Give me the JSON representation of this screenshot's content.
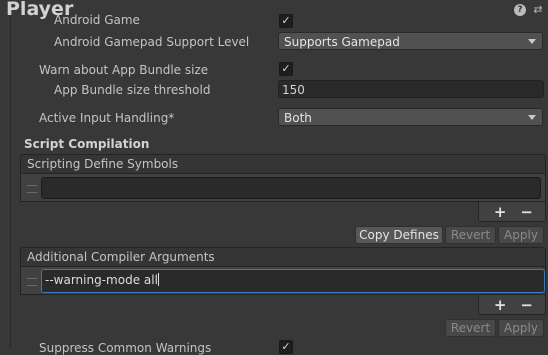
{
  "header": {
    "title": "Player"
  },
  "settings": {
    "android_game_label": "Android Game",
    "android_game_checked": true,
    "gamepad_label": "Android Gamepad Support Level",
    "gamepad_value": "Supports Gamepad",
    "warn_bundle_label": "Warn about App Bundle size",
    "warn_bundle_checked": true,
    "threshold_label": "App Bundle size threshold",
    "threshold_value": "150",
    "input_label": "Active Input Handling*",
    "input_value": "Both"
  },
  "script_compilation": {
    "title": "Script Compilation",
    "define_symbols": {
      "header": "Scripting Define Symbols",
      "items": [
        ""
      ],
      "copy_label": "Copy Defines",
      "revert_label": "Revert",
      "apply_label": "Apply"
    },
    "compiler_args": {
      "header": "Additional Compiler Arguments",
      "items": [
        "--warning-mode all"
      ],
      "revert_label": "Revert",
      "apply_label": "Apply"
    },
    "plus_label": "+",
    "minus_label": "−",
    "suppress_label": "Suppress Common Warnings",
    "suppress_checked": true
  },
  "icons": {
    "check": "✓",
    "help": "?",
    "settings": "⇄"
  }
}
